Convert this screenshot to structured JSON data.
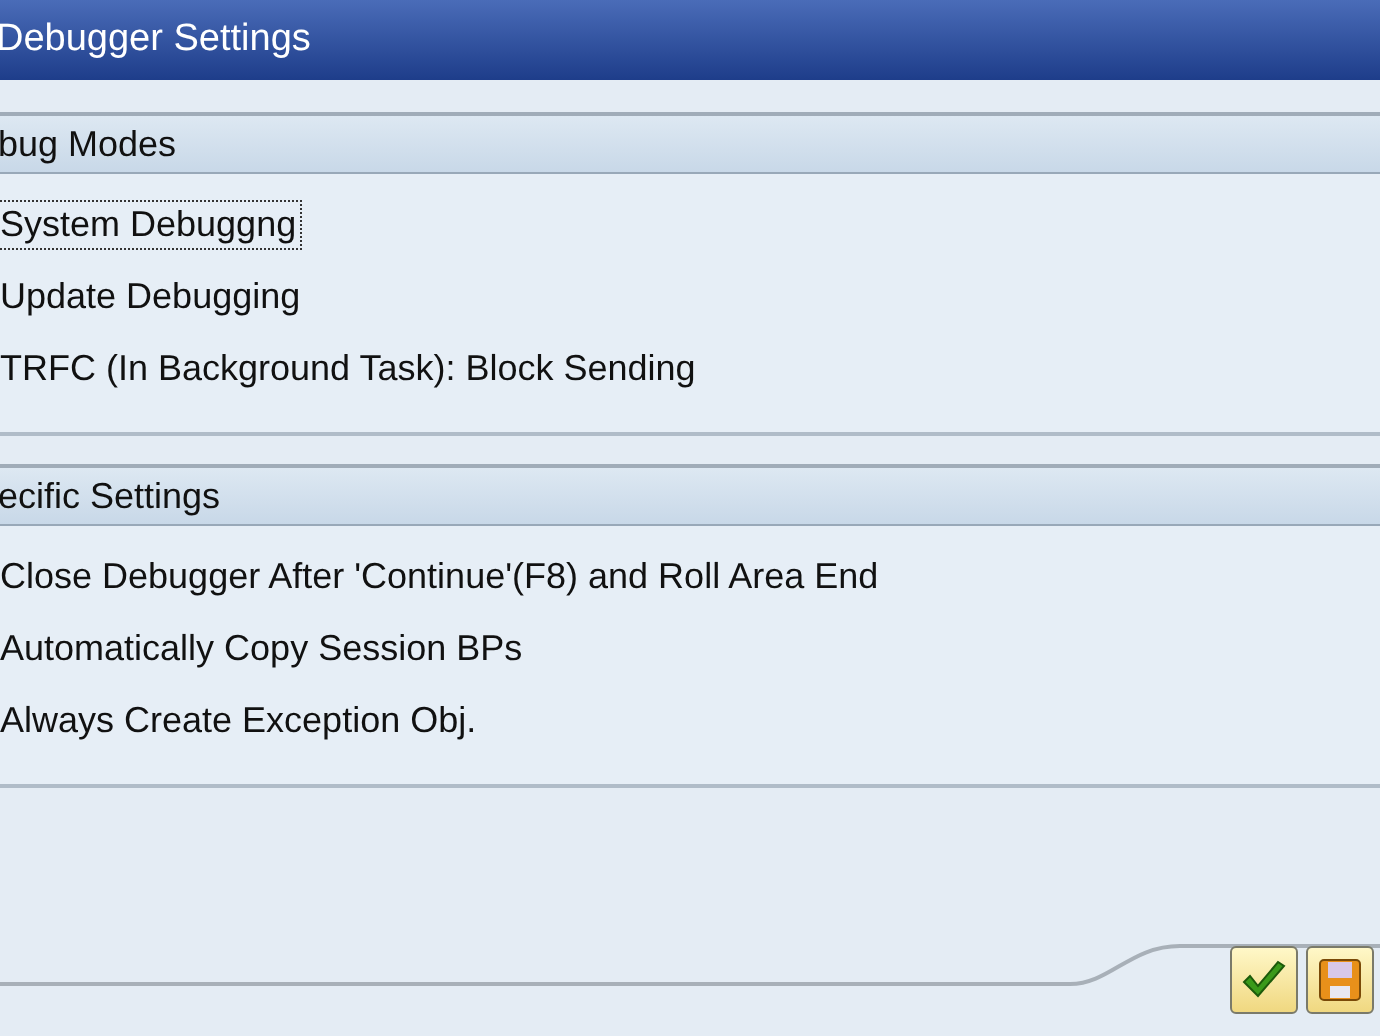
{
  "window": {
    "title": "Debugger Settings"
  },
  "groups": [
    {
      "title": "bug Modes",
      "items": [
        {
          "label": "System Debuggng",
          "focused": true
        },
        {
          "label": "Update Debugging",
          "focused": false
        },
        {
          "label": "TRFC (In Background Task): Block Sending",
          "focused": false
        }
      ]
    },
    {
      "title": "ecific Settings",
      "items": [
        {
          "label": "Close Debugger After 'Continue'(F8) and Roll Area End",
          "focused": false
        },
        {
          "label": "Automatically Copy Session BPs",
          "focused": false
        },
        {
          "label": "Always Create Exception Obj.",
          "focused": false
        }
      ]
    }
  ],
  "buttons": [
    {
      "kind": "confirm"
    },
    {
      "kind": "save"
    }
  ]
}
